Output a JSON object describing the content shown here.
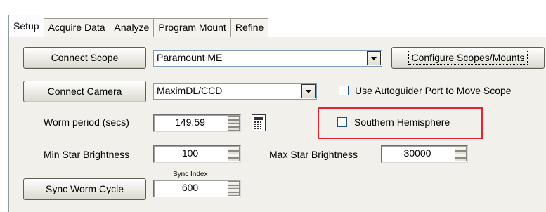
{
  "tabs": [
    {
      "label": "Setup",
      "active": true
    },
    {
      "label": "Acquire Data",
      "active": false
    },
    {
      "label": "Analyze",
      "active": false
    },
    {
      "label": "Program Mount",
      "active": false
    },
    {
      "label": "Refine",
      "active": false
    }
  ],
  "setup": {
    "connect_scope_label": "Connect Scope",
    "scope_combo_value": "Paramount ME",
    "configure_scopes_label": "Configure Scopes/Mounts",
    "connect_camera_label": "Connect Camera",
    "camera_combo_value": "MaximDL/CCD",
    "autoguider_checkbox_label": "Use Autoguider Port to Move Scope",
    "autoguider_checked": false,
    "worm_period_label": "Worm period (secs)",
    "worm_period_value": "149.59",
    "southern_hemisphere_label": "Southern Hemisphere",
    "southern_hemisphere_checked": false,
    "min_star_label": "Min Star Brightness",
    "min_star_value": "100",
    "max_star_label": "Max Star Brightness",
    "max_star_value": "30000",
    "sync_index_label": "Sync Index",
    "sync_index_value": "600",
    "sync_worm_label": "Sync Worm Cycle"
  },
  "colors": {
    "highlight_border": "#e8222c",
    "panel_bg": "#f1f0ea"
  },
  "icons": {
    "calculator": "calculator-icon"
  }
}
